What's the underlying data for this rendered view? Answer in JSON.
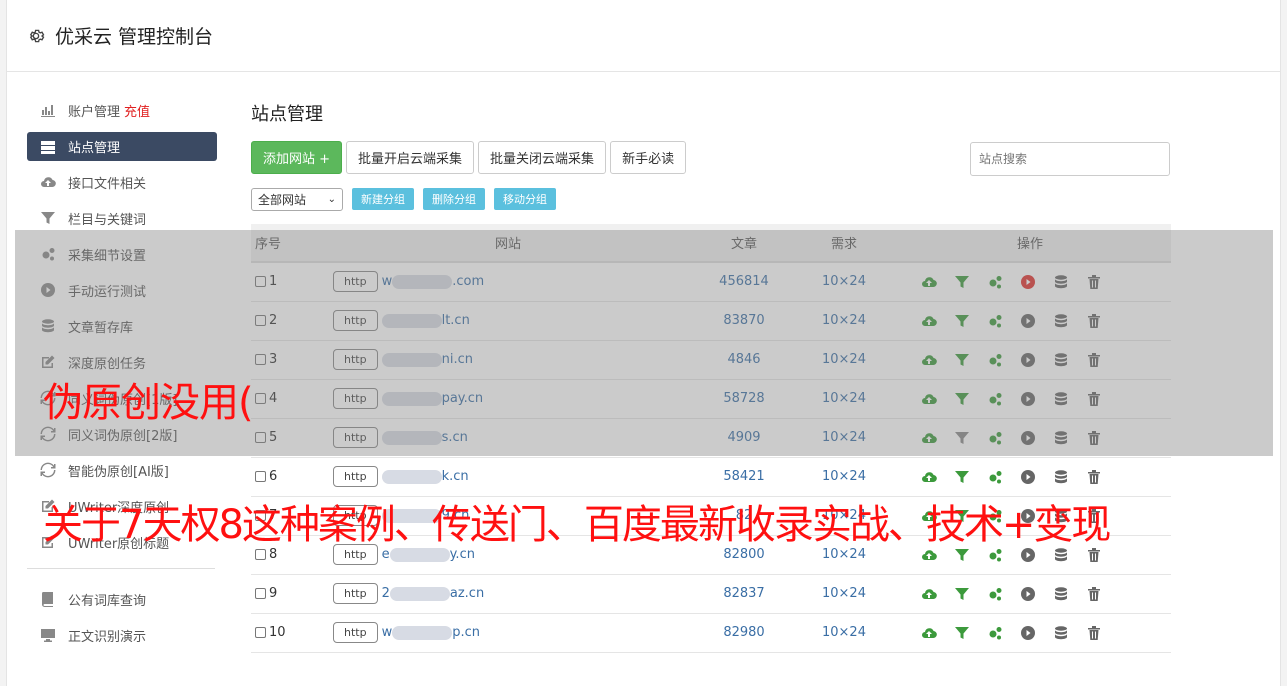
{
  "header": {
    "title": "优采云 管理控制台"
  },
  "sidebar": {
    "items": [
      {
        "label": "账户管理",
        "extra": "充值",
        "icon": "bar-chart-icon"
      },
      {
        "label": "站点管理",
        "icon": "server-icon",
        "active": true
      },
      {
        "label": "接口文件相关",
        "icon": "cloud-upload-icon"
      },
      {
        "label": "栏目与关键词",
        "icon": "filter-icon"
      },
      {
        "label": "采集细节设置",
        "icon": "gears-icon"
      },
      {
        "label": "手动运行测试",
        "icon": "play-circle-icon"
      },
      {
        "label": "文章暂存库",
        "icon": "database-icon"
      },
      {
        "label": "深度原创任务",
        "icon": "edit-icon"
      },
      {
        "label": "同义词伪原创[1版]",
        "icon": "refresh-icon"
      },
      {
        "label": "同义词伪原创[2版]",
        "icon": "refresh-icon"
      },
      {
        "label": "智能伪原创[AI版]",
        "icon": "refresh-icon"
      },
      {
        "label": "UWriter深度原创",
        "icon": "edit-icon"
      },
      {
        "label": "UWriter原创标题",
        "icon": "edit-icon"
      }
    ],
    "items2": [
      {
        "label": "公有词库查询",
        "icon": "book-icon"
      },
      {
        "label": "正文识别演示",
        "icon": "monitor-icon"
      }
    ]
  },
  "main": {
    "title": "站点管理",
    "add_label": "添加网站 +",
    "batch_on_label": "批量开启云端采集",
    "batch_off_label": "批量关闭云端采集",
    "guide_label": "新手必读",
    "search_placeholder": "站点搜索",
    "group_select": "全部网站",
    "new_group": "新建分组",
    "del_group": "删除分组",
    "move_group": "移动分组",
    "columns": {
      "no": "序号",
      "site": "网站",
      "articles": "文章",
      "demand": "需求",
      "ops": "操作"
    },
    "rows": [
      {
        "no": "1",
        "proto": "http",
        "prefix": "w",
        "domain": ".com",
        "articles": "456814",
        "demand": "10×24",
        "active_play": true,
        "filter_on": true
      },
      {
        "no": "2",
        "proto": "http",
        "prefix": "",
        "domain": "lt.cn",
        "articles": "83870",
        "demand": "10×24",
        "active_play": false,
        "filter_on": true
      },
      {
        "no": "3",
        "proto": "http",
        "prefix": "",
        "domain": "ni.cn",
        "articles": "4846",
        "demand": "10×24",
        "active_play": false,
        "filter_on": true
      },
      {
        "no": "4",
        "proto": "http",
        "prefix": "",
        "domain": "pay.cn",
        "articles": "58728",
        "demand": "10×24",
        "active_play": false,
        "filter_on": true
      },
      {
        "no": "5",
        "proto": "http",
        "prefix": "",
        "domain": "s.cn",
        "articles": "4909",
        "demand": "10×24",
        "active_play": false,
        "filter_on": false
      },
      {
        "no": "6",
        "proto": "http",
        "prefix": "",
        "domain": "k.cn",
        "articles": "58421",
        "demand": "10×24",
        "active_play": false,
        "filter_on": true
      },
      {
        "no": "7",
        "proto": "http",
        "prefix": "",
        "domain": "9.cn",
        "articles": "82",
        "demand": "10×24",
        "active_play": false,
        "filter_on": true
      },
      {
        "no": "8",
        "proto": "http",
        "prefix": "e",
        "domain": "y.cn",
        "articles": "82800",
        "demand": "10×24",
        "active_play": false,
        "filter_on": true
      },
      {
        "no": "9",
        "proto": "http",
        "prefix": "2",
        "domain": "az.cn",
        "articles": "82837",
        "demand": "10×24",
        "active_play": false,
        "filter_on": true
      },
      {
        "no": "10",
        "proto": "http",
        "prefix": "w",
        "domain": "p.cn",
        "articles": "82980",
        "demand": "10×24",
        "active_play": false,
        "filter_on": true
      }
    ]
  },
  "overlay": {
    "caption1": "伪原创没用(",
    "caption2": "关于7天权8这种案例、传送门、百度最新收录实战、技术+变现"
  },
  "colors": {
    "green": "#5cb85c",
    "link": "#3a6ea5",
    "sidebar_active": "#3b4a63",
    "caption": "#ff1010",
    "info": "#5bc0de"
  }
}
